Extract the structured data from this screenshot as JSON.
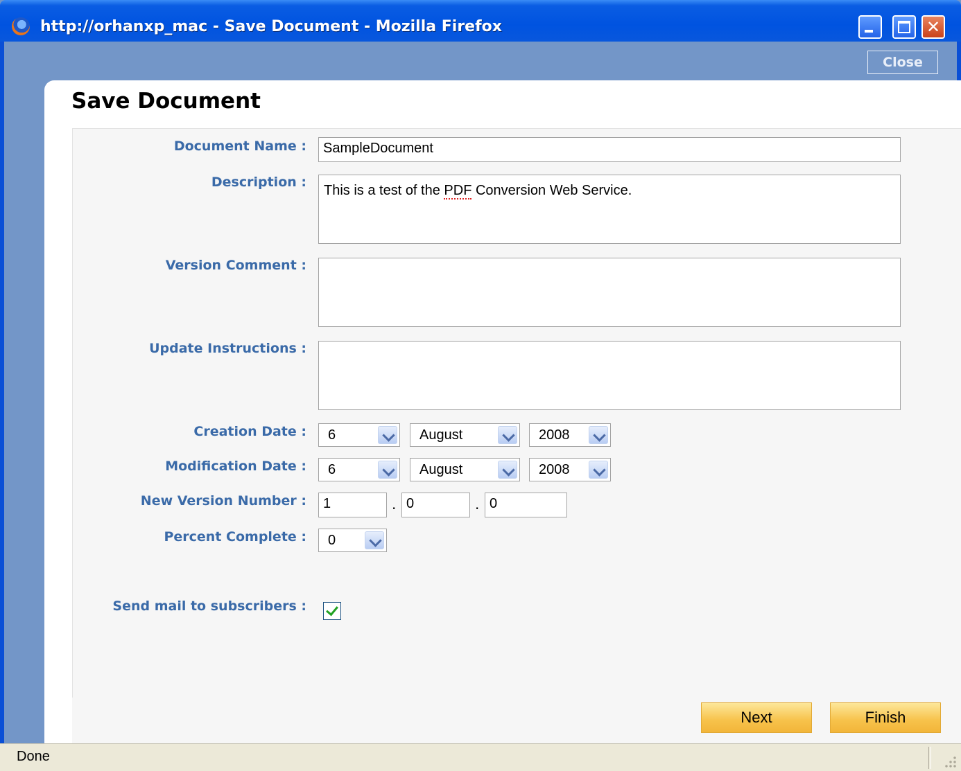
{
  "window": {
    "title": "http://orhanxp_mac - Save Document - Mozilla Firefox",
    "minimize_icon": "minimize-icon",
    "maximize_icon": "maximize-icon",
    "close_icon": "close-x-icon"
  },
  "header": {
    "close_label": "Close"
  },
  "dialog": {
    "title": "Save Document"
  },
  "form": {
    "document_name": {
      "label": "Document Name :",
      "value": "SampleDocument"
    },
    "description": {
      "label": "Description :",
      "value_before": "This is a test of the ",
      "value_misspelled": "PDF",
      "value_after": " Conversion Web Service."
    },
    "version_comment": {
      "label": "Version Comment :",
      "value": ""
    },
    "update_instructions": {
      "label": "Update Instructions :",
      "value": ""
    },
    "creation_date": {
      "label": "Creation Date :",
      "day": "6",
      "month": "August",
      "year": "2008"
    },
    "modification_date": {
      "label": "Modification Date :",
      "day": "6",
      "month": "August",
      "year": "2008"
    },
    "new_version_number": {
      "label": "New Version Number :",
      "major": "1",
      "minor": "0",
      "patch": "0",
      "separator": "."
    },
    "percent_complete": {
      "label": "Percent Complete :",
      "value": "0"
    },
    "send_mail": {
      "label": "Send mail to subscribers :",
      "checked": true
    }
  },
  "buttons": {
    "next": "Next",
    "finish": "Finish"
  },
  "status": {
    "text": "Done"
  },
  "colors": {
    "titlebar": "#0053e0",
    "client_bg": "#7396c8",
    "label": "#3a6aa8",
    "button": "#f7c24a"
  }
}
